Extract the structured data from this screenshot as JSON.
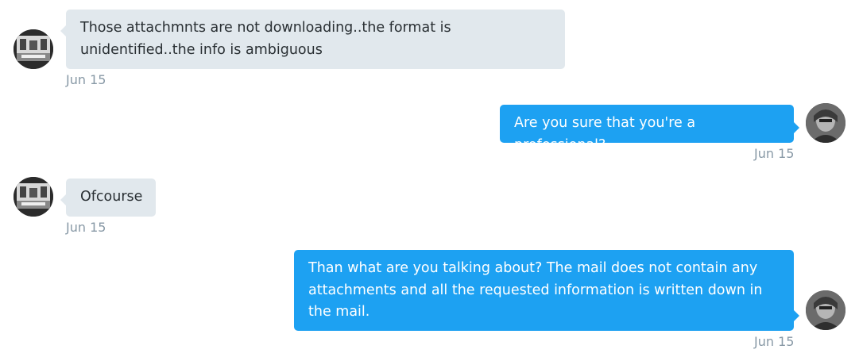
{
  "conversation": {
    "messages": [
      {
        "direction": "incoming",
        "text": "Those attachmnts are not downloading..the format is unidentified..the info is ambiguous",
        "time": "Jun 15"
      },
      {
        "direction": "outgoing",
        "text": "Are you sure that you're a professional?",
        "time": "Jun 15"
      },
      {
        "direction": "incoming",
        "text": "Ofcourse",
        "time": "Jun 15"
      },
      {
        "direction": "outgoing",
        "text": "Than what are you talking about? The mail does not contain any attachments and all the requested information is written down in the mail.",
        "time": "Jun 15"
      }
    ]
  },
  "colors": {
    "incoming_bubble": "#e1e8ed",
    "outgoing_bubble": "#1da1f2",
    "timestamp": "#8899a6"
  }
}
